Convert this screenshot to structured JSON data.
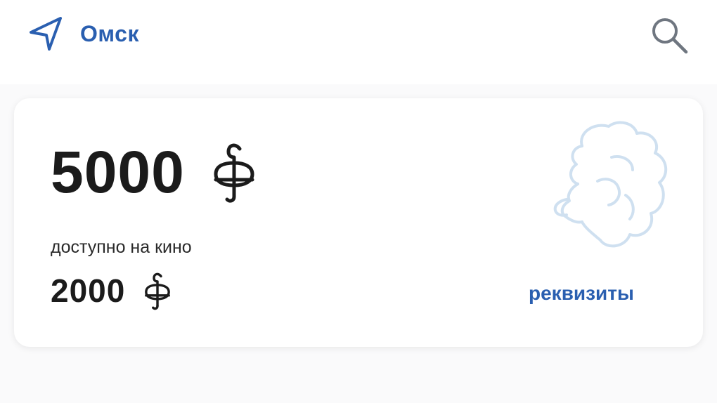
{
  "header": {
    "city": "Омск",
    "location_icon": "navigation-arrow-icon",
    "search_icon": "search-icon"
  },
  "card": {
    "balance_amount": "5000",
    "balance_currency_icon": "pushkin-ruble-icon",
    "cinema_label": "доступно на кино",
    "cinema_amount": "2000",
    "cinema_currency_icon": "pushkin-ruble-icon",
    "requisites_link": "реквизиты",
    "watermark_icon": "pushkin-portrait-icon"
  },
  "colors": {
    "accent": "#2a5fb0",
    "text": "#1b1b1b",
    "watermark": "#cfe0f0",
    "page_background": "#fafafb"
  }
}
